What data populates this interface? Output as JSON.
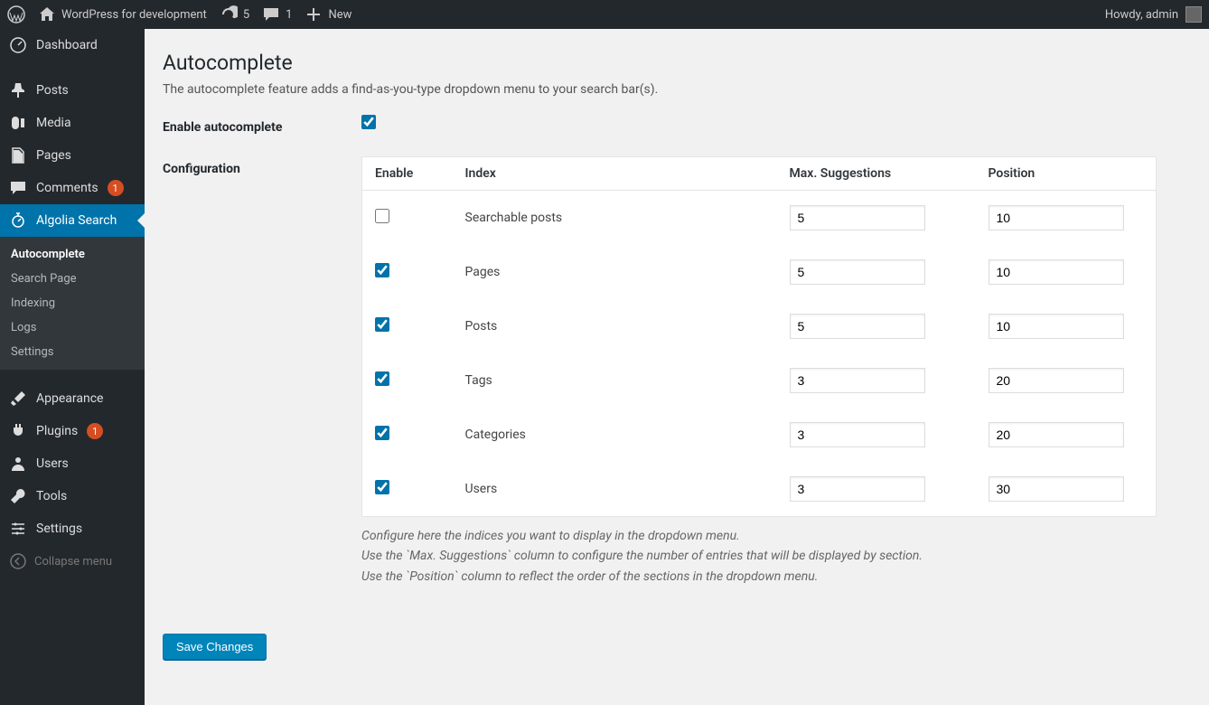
{
  "adminbar": {
    "site_name": "WordPress for development",
    "updates": "5",
    "comments": "1",
    "new_label": "New",
    "howdy": "Howdy, admin"
  },
  "sidebar": {
    "dashboard": "Dashboard",
    "posts": "Posts",
    "media": "Media",
    "pages": "Pages",
    "comments": "Comments",
    "comments_badge": "1",
    "algolia": "Algolia Search",
    "sub_autocomplete": "Autocomplete",
    "sub_searchpage": "Search Page",
    "sub_indexing": "Indexing",
    "sub_logs": "Logs",
    "sub_settings": "Settings",
    "appearance": "Appearance",
    "plugins": "Plugins",
    "plugins_badge": "1",
    "users": "Users",
    "tools": "Tools",
    "settings": "Settings",
    "collapse": "Collapse menu"
  },
  "page": {
    "title": "Autocomplete",
    "description": "The autocomplete feature adds a find-as-you-type dropdown menu to your search bar(s).",
    "enable_label": "Enable autocomplete",
    "config_label": "Configuration",
    "save_label": "Save Changes",
    "help1": "Configure here the indices you want to display in the dropdown menu.",
    "help2": "Use the `Max. Suggestions` column to configure the number of entries that will be displayed by section.",
    "help3": "Use the `Position` column to reflect the order of the sections in the dropdown menu."
  },
  "table": {
    "th_enable": "Enable",
    "th_index": "Index",
    "th_max": "Max. Suggestions",
    "th_position": "Position",
    "rows": [
      {
        "enabled": false,
        "index": "Searchable posts",
        "max": "5",
        "position": "10"
      },
      {
        "enabled": true,
        "index": "Pages",
        "max": "5",
        "position": "10"
      },
      {
        "enabled": true,
        "index": "Posts",
        "max": "5",
        "position": "10"
      },
      {
        "enabled": true,
        "index": "Tags",
        "max": "3",
        "position": "20"
      },
      {
        "enabled": true,
        "index": "Categories",
        "max": "3",
        "position": "20"
      },
      {
        "enabled": true,
        "index": "Users",
        "max": "3",
        "position": "30"
      }
    ]
  }
}
